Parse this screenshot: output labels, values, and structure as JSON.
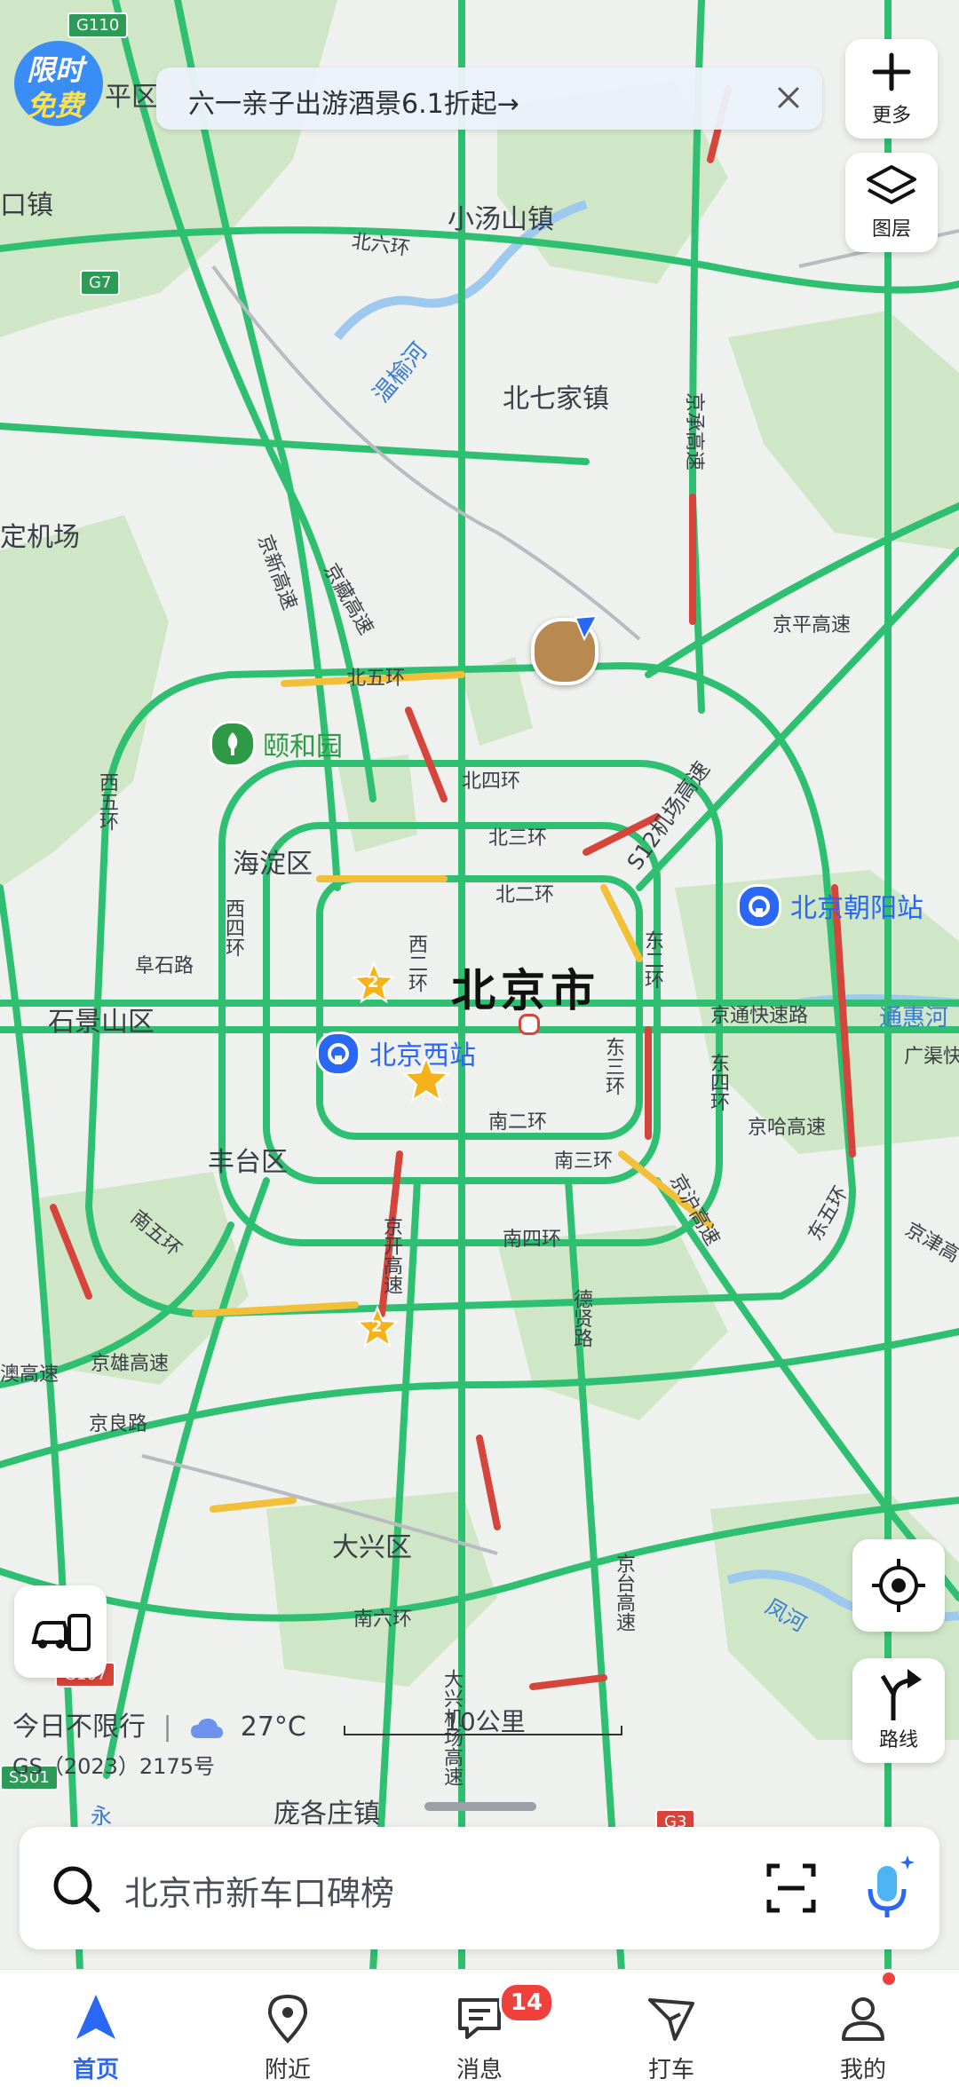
{
  "promo": {
    "line1": "限时",
    "line2": "免费"
  },
  "banner": {
    "text": "六一亲子出游酒景6.1折起→"
  },
  "side": {
    "more_label": "更多",
    "layers_label": "图层",
    "route_label": "路线"
  },
  "map": {
    "labels": [
      {
        "id": "pingu",
        "text": "平区"
      },
      {
        "id": "kouzhen",
        "text": "口镇"
      },
      {
        "id": "xiaotangshan",
        "text": "小汤山镇"
      },
      {
        "id": "beiliuhuan",
        "text": "北六环"
      },
      {
        "id": "wenyuhe",
        "text": "温榆河"
      },
      {
        "id": "beiqijia",
        "text": "北七家镇"
      },
      {
        "id": "jingcheng",
        "text": "京承高速"
      },
      {
        "id": "dingjichang",
        "text": "定机场"
      },
      {
        "id": "jingxin",
        "text": "京新高速"
      },
      {
        "id": "jingzang",
        "text": "京藏高速"
      },
      {
        "id": "jingping",
        "text": "京平高速"
      },
      {
        "id": "beiwuhuan",
        "text": "北五环"
      },
      {
        "id": "yiheyuan",
        "text": "颐和园"
      },
      {
        "id": "beisihuan",
        "text": "北四环"
      },
      {
        "id": "xiwuhuan",
        "text": "西五环"
      },
      {
        "id": "jichang",
        "text": "S12机场高速"
      },
      {
        "id": "haidian",
        "text": "海淀区"
      },
      {
        "id": "beisanhuan",
        "text": "北三环"
      },
      {
        "id": "beierhuan",
        "text": "北二环"
      },
      {
        "id": "chaoyangzhan",
        "text": "北京朝阳站"
      },
      {
        "id": "xisihuan",
        "text": "西四环"
      },
      {
        "id": "fushilu",
        "text": "阜石路"
      },
      {
        "id": "xierhuan",
        "text": "西二环"
      },
      {
        "id": "dongerhuan",
        "text": "东二环"
      },
      {
        "id": "beijingshi",
        "text": "北京市"
      },
      {
        "id": "shijingshan",
        "text": "石景山区"
      },
      {
        "id": "jingtong",
        "text": "京通快速路"
      },
      {
        "id": "tonghuihe",
        "text": "通惠河"
      },
      {
        "id": "xizhan",
        "text": "北京西站"
      },
      {
        "id": "dongsanhuan",
        "text": "东三环"
      },
      {
        "id": "dongsihuan",
        "text": "东四环"
      },
      {
        "id": "guangqu",
        "text": "广渠快"
      },
      {
        "id": "naneriuan",
        "text": "南二环"
      },
      {
        "id": "jingha",
        "text": "京哈高速"
      },
      {
        "id": "fengtai",
        "text": "丰台区"
      },
      {
        "id": "nansanhuan",
        "text": "南三环"
      },
      {
        "id": "jinghu",
        "text": "京沪高速"
      },
      {
        "id": "dongwuhuan",
        "text": "东五环"
      },
      {
        "id": "nanwuhuan",
        "text": "南五环"
      },
      {
        "id": "nansihuan",
        "text": "南四环"
      },
      {
        "id": "jingkai",
        "text": "京开高速"
      },
      {
        "id": "jingjin",
        "text": "京津高"
      },
      {
        "id": "dexian",
        "text": "德贤路"
      },
      {
        "id": "aogaosu",
        "text": "澳高速"
      },
      {
        "id": "jingxiong",
        "text": "京雄高速"
      },
      {
        "id": "jingliang",
        "text": "京良路"
      },
      {
        "id": "daxing",
        "text": "大兴区"
      },
      {
        "id": "jingtai",
        "text": "京台高速"
      },
      {
        "id": "fenghe",
        "text": "凤河"
      },
      {
        "id": "nanliuhuan",
        "text": "南六环"
      },
      {
        "id": "daxingjichang",
        "text": "大兴机场高速"
      },
      {
        "id": "panggezhuang",
        "text": "庞各庄镇"
      },
      {
        "id": "yong",
        "text": "永"
      }
    ],
    "shields": [
      {
        "id": "g110",
        "text": "G110"
      },
      {
        "id": "g7",
        "text": "G7"
      },
      {
        "id": "g107",
        "text": "G107"
      },
      {
        "id": "s501",
        "text": "S501"
      },
      {
        "id": "g3",
        "text": "G3"
      }
    ],
    "markers": {
      "star_count": "2",
      "poi_star2_count": "2"
    }
  },
  "status": {
    "restriction": "今日不限行",
    "divider": "|",
    "temperature": "27°C",
    "scale": "10公里",
    "gs": "GS（2023）2175号"
  },
  "search": {
    "placeholder": "北京市新车口碑榜"
  },
  "tabs": [
    {
      "label": "首页",
      "active": true
    },
    {
      "label": "附近"
    },
    {
      "label": "消息",
      "badge": "14"
    },
    {
      "label": "打车"
    },
    {
      "label": "我的"
    }
  ],
  "colors": {
    "accent": "#2a67f4",
    "road_green": "#2fbf71",
    "road_yellow": "#f2c038",
    "road_red": "#d6453b",
    "badge": "#f0403b"
  }
}
